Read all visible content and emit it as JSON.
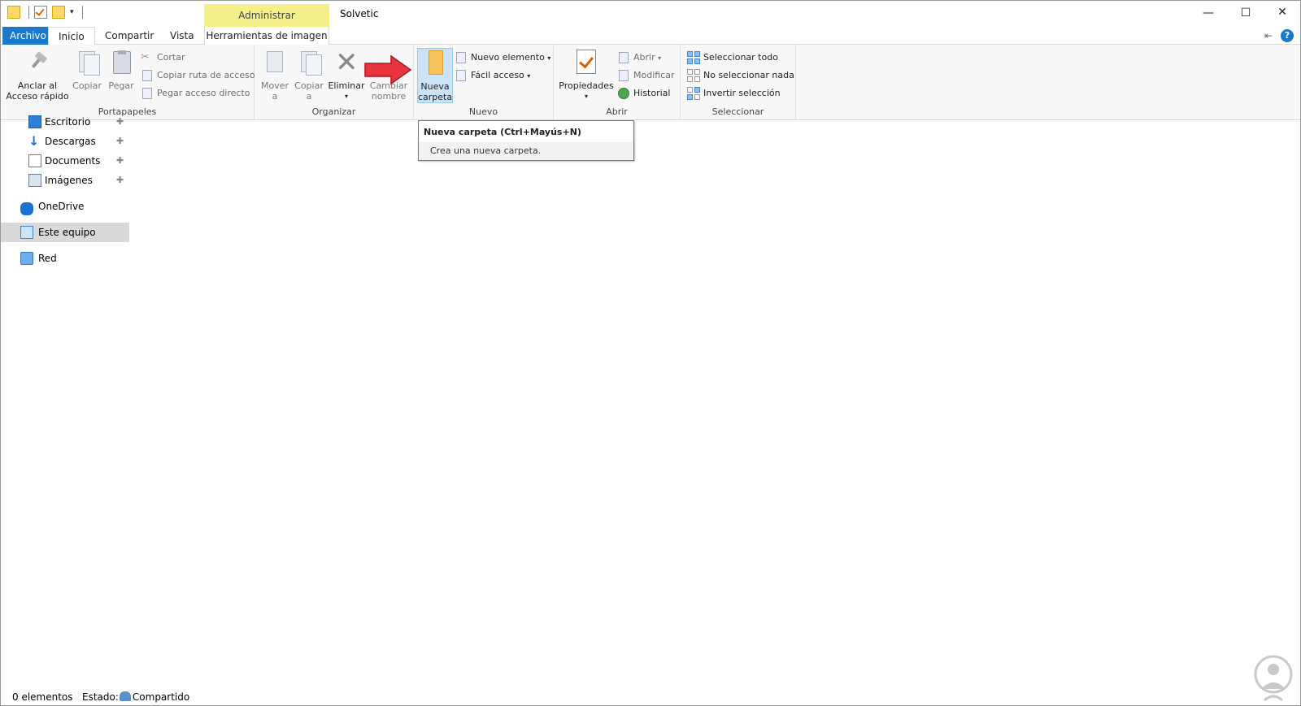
{
  "titlebar": {
    "contextual_tab": "Administrar",
    "window_title": "Solvetic",
    "minimize": "—",
    "maximize": "☐",
    "close": "✕"
  },
  "tabs": {
    "file": "Archivo",
    "home": "Inicio",
    "share": "Compartir",
    "view": "Vista",
    "image_tools": "Herramientas de imagen"
  },
  "ribbon": {
    "clipboard": {
      "label": "Portapapeles",
      "pin_line1": "Anclar al",
      "pin_line2": "Acceso rápido",
      "copy": "Copiar",
      "paste": "Pegar",
      "cut": "Cortar",
      "copy_path": "Copiar ruta de acceso",
      "paste_shortcut": "Pegar acceso directo"
    },
    "organize": {
      "label": "Organizar",
      "move_line1": "Mover",
      "move_line2": "a",
      "copy_line1": "Copiar",
      "copy_line2": "a",
      "delete": "Eliminar",
      "rename_line1": "Cambiar",
      "rename_line2": "nombre"
    },
    "new": {
      "label": "Nuevo",
      "new_folder_line1": "Nueva",
      "new_folder_line2": "carpeta",
      "new_item": "Nuevo elemento",
      "easy_access": "Fácil acceso"
    },
    "open": {
      "label": "Abrir",
      "properties": "Propiedades",
      "open": "Abrir",
      "edit": "Modificar",
      "history": "Historial"
    },
    "select": {
      "label": "Seleccionar",
      "select_all": "Seleccionar todo",
      "select_none": "No seleccionar nada",
      "invert": "Invertir selección"
    }
  },
  "tooltip": {
    "title": "Nueva carpeta (Ctrl+Mayús+N)",
    "body": "Crea una nueva carpeta."
  },
  "nav": {
    "items": [
      {
        "label": "Escritorio",
        "icon": "desktop-icon",
        "pinned": true
      },
      {
        "label": "Descargas",
        "icon": "download-icon",
        "pinned": true
      },
      {
        "label": "Documents",
        "icon": "documents-icon",
        "pinned": true
      },
      {
        "label": "Imágenes",
        "icon": "pictures-icon",
        "pinned": true
      },
      {
        "label": "OneDrive",
        "icon": "onedrive-icon",
        "pinned": false
      },
      {
        "label": "Este equipo",
        "icon": "this-pc-icon",
        "pinned": false,
        "selected": true
      },
      {
        "label": "Red",
        "icon": "network-icon",
        "pinned": false
      }
    ]
  },
  "status": {
    "count": "0 elementos",
    "state_label": "Estado:",
    "state_value": "Compartido"
  },
  "colors": {
    "file_tab": "#1979ca",
    "contextual_tab": "#f4f18a",
    "highlight_arrow": "#e8343c"
  }
}
